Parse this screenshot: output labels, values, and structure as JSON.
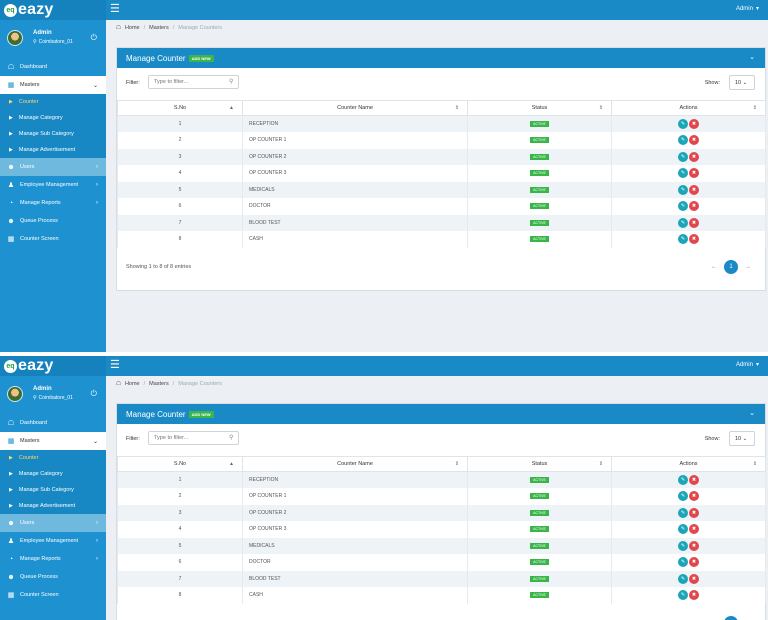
{
  "brand": {
    "logo_mark": "eq",
    "name": "eazy"
  },
  "header": {
    "admin_label": "Admin",
    "caret": "▾"
  },
  "user": {
    "name": "Admin",
    "location": "Coimbatore_01"
  },
  "sidebar": {
    "items": [
      {
        "label": "Dashboard",
        "icon": "home-icon"
      },
      {
        "label": "Masters",
        "icon": "grid-icon"
      },
      {
        "label": "Users",
        "icon": "users-icon"
      },
      {
        "label": "Employee Management",
        "icon": "person-icon"
      },
      {
        "label": "Manage Reports",
        "icon": "pie-chart-icon"
      },
      {
        "label": "Queue Process",
        "icon": "group-icon"
      },
      {
        "label": "Counter Screen",
        "icon": "grid-icon"
      }
    ],
    "sub_items": [
      {
        "label": "Counter"
      },
      {
        "label": "Manage Category"
      },
      {
        "label": "Manage Sub Category"
      },
      {
        "label": "Manage Advertisement"
      }
    ]
  },
  "breadcrumb": {
    "home": "Home",
    "sep": "/",
    "masters": "Masters",
    "current": "Manage Counters"
  },
  "panel": {
    "title": "Manage Counter",
    "add_label": "ADD NEW"
  },
  "filter": {
    "label": "Filter:",
    "placeholder": "Type to filter...",
    "show_label": "Show:",
    "show_value": "10"
  },
  "table": {
    "headers": [
      "S.No",
      "Counter Name",
      "Status",
      "Actions"
    ],
    "rows": [
      {
        "sno": "1",
        "name": "RECEPTION",
        "status": "ACTIVE"
      },
      {
        "sno": "2",
        "name": "OP COUNTER 1",
        "status": "ACTIVE"
      },
      {
        "sno": "3",
        "name": "OP COUNTER 2",
        "status": "ACTIVE"
      },
      {
        "sno": "4",
        "name": "OP COUNTER 3",
        "status": "ACTIVE"
      },
      {
        "sno": "5",
        "name": "MEDICALS",
        "status": "ACTIVE"
      },
      {
        "sno": "6",
        "name": "DOCTOR",
        "status": "ACTIVE"
      },
      {
        "sno": "7",
        "name": "BLOOD TEST",
        "status": "ACTIVE"
      },
      {
        "sno": "8",
        "name": "CASH",
        "status": "ACTIVE"
      }
    ]
  },
  "footer": {
    "entries_text": "Showing 1 to 8 of 8 entries",
    "prev": "←",
    "page": "1",
    "next": "→"
  },
  "colors": {
    "topbar": "#1a8ac7",
    "sidebar": "#1e92d0",
    "active_badge": "#3ab54a",
    "edit_button": "#1aa6b7",
    "delete_button": "#e0474c"
  }
}
